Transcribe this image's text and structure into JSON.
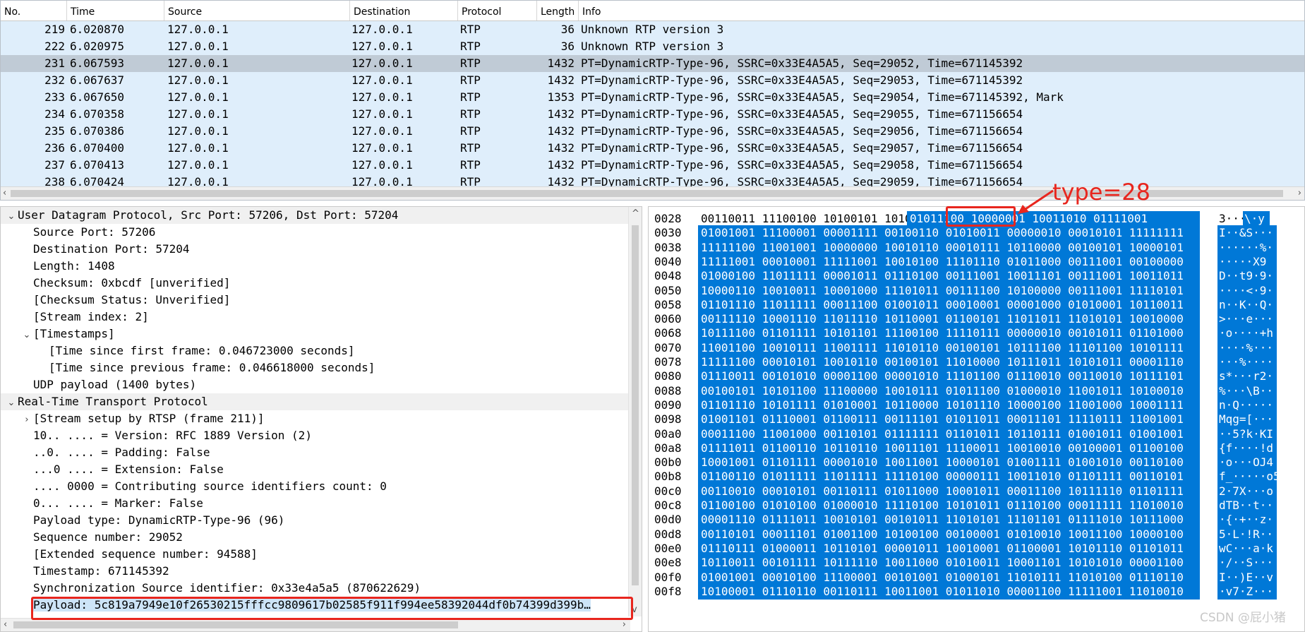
{
  "packet_list": {
    "columns": [
      "No.",
      "Time",
      "Source",
      "Destination",
      "Protocol",
      "Length",
      "Info"
    ],
    "rows": [
      {
        "no": "219",
        "time": "6.020870",
        "src": "127.0.0.1",
        "dst": "127.0.0.1",
        "proto": "RTP",
        "len": "36",
        "info": "Unknown RTP version 3"
      },
      {
        "no": "222",
        "time": "6.020975",
        "src": "127.0.0.1",
        "dst": "127.0.0.1",
        "proto": "RTP",
        "len": "36",
        "info": "Unknown RTP version 3"
      },
      {
        "no": "231",
        "time": "6.067593",
        "src": "127.0.0.1",
        "dst": "127.0.0.1",
        "proto": "RTP",
        "len": "1432",
        "info": "PT=DynamicRTP-Type-96, SSRC=0x33E4A5A5, Seq=29052, Time=671145392"
      },
      {
        "no": "232",
        "time": "6.067637",
        "src": "127.0.0.1",
        "dst": "127.0.0.1",
        "proto": "RTP",
        "len": "1432",
        "info": "PT=DynamicRTP-Type-96, SSRC=0x33E4A5A5, Seq=29053, Time=671145392"
      },
      {
        "no": "233",
        "time": "6.067650",
        "src": "127.0.0.1",
        "dst": "127.0.0.1",
        "proto": "RTP",
        "len": "1353",
        "info": "PT=DynamicRTP-Type-96, SSRC=0x33E4A5A5, Seq=29054, Time=671145392, Mark"
      },
      {
        "no": "234",
        "time": "6.070358",
        "src": "127.0.0.1",
        "dst": "127.0.0.1",
        "proto": "RTP",
        "len": "1432",
        "info": "PT=DynamicRTP-Type-96, SSRC=0x33E4A5A5, Seq=29055, Time=671156654"
      },
      {
        "no": "235",
        "time": "6.070386",
        "src": "127.0.0.1",
        "dst": "127.0.0.1",
        "proto": "RTP",
        "len": "1432",
        "info": "PT=DynamicRTP-Type-96, SSRC=0x33E4A5A5, Seq=29056, Time=671156654"
      },
      {
        "no": "236",
        "time": "6.070400",
        "src": "127.0.0.1",
        "dst": "127.0.0.1",
        "proto": "RTP",
        "len": "1432",
        "info": "PT=DynamicRTP-Type-96, SSRC=0x33E4A5A5, Seq=29057, Time=671156654"
      },
      {
        "no": "237",
        "time": "6.070413",
        "src": "127.0.0.1",
        "dst": "127.0.0.1",
        "proto": "RTP",
        "len": "1432",
        "info": "PT=DynamicRTP-Type-96, SSRC=0x33E4A5A5, Seq=29058, Time=671156654"
      },
      {
        "no": "238",
        "time": "6.070424",
        "src": "127.0.0.1",
        "dst": "127.0.0.1",
        "proto": "RTP",
        "len": "1432",
        "info": "PT=DynamicRTP-Type-96, SSRC=0x33E4A5A5, Seq=29059, Time=671156654"
      }
    ],
    "selected_no": "231"
  },
  "details": {
    "rows": [
      {
        "text": "User Datagram Protocol, Src Port: 57206, Dst Port: 57204",
        "toggle": "v",
        "indent": 0,
        "header": true
      },
      {
        "text": "Source Port: 57206",
        "toggle": "",
        "indent": 1
      },
      {
        "text": "Destination Port: 57204",
        "toggle": "",
        "indent": 1
      },
      {
        "text": "Length: 1408",
        "toggle": "",
        "indent": 1
      },
      {
        "text": "Checksum: 0xbcdf [unverified]",
        "toggle": "",
        "indent": 1
      },
      {
        "text": "[Checksum Status: Unverified]",
        "toggle": "",
        "indent": 1
      },
      {
        "text": "[Stream index: 2]",
        "toggle": "",
        "indent": 1
      },
      {
        "text": "[Timestamps]",
        "toggle": "v",
        "indent": 1
      },
      {
        "text": "[Time since first frame: 0.046723000 seconds]",
        "toggle": "",
        "indent": 2
      },
      {
        "text": "[Time since previous frame: 0.046618000 seconds]",
        "toggle": "",
        "indent": 2
      },
      {
        "text": "UDP payload (1400 bytes)",
        "toggle": "",
        "indent": 1
      },
      {
        "text": "Real-Time Transport Protocol",
        "toggle": "v",
        "indent": 0,
        "header": true
      },
      {
        "text": "[Stream setup by RTSP (frame 211)]",
        "toggle": ">",
        "indent": 1
      },
      {
        "text": "10.. .... = Version: RFC 1889 Version (2)",
        "toggle": "",
        "indent": 1
      },
      {
        "text": "..0. .... = Padding: False",
        "toggle": "",
        "indent": 1
      },
      {
        "text": "...0 .... = Extension: False",
        "toggle": "",
        "indent": 1
      },
      {
        "text": ".... 0000 = Contributing source identifiers count: 0",
        "toggle": "",
        "indent": 1
      },
      {
        "text": "0... .... = Marker: False",
        "toggle": "",
        "indent": 1
      },
      {
        "text": "Payload type: DynamicRTP-Type-96 (96)",
        "toggle": "",
        "indent": 1
      },
      {
        "text": "Sequence number: 29052",
        "toggle": "",
        "indent": 1
      },
      {
        "text": "[Extended sequence number: 94588]",
        "toggle": "",
        "indent": 1
      },
      {
        "text": "Timestamp: 671145392",
        "toggle": "",
        "indent": 1
      },
      {
        "text": "Synchronization Source identifier: 0x33e4a5a5 (870622629)",
        "toggle": "",
        "indent": 1
      },
      {
        "text": "Payload: 5c819a7949e10f26530215fffcc9809617b02585f911f994ee58392044df0b74399d399b…",
        "toggle": "",
        "indent": 1,
        "selected": true
      }
    ]
  },
  "bytes": {
    "rows": [
      {
        "offset": "0028",
        "pre": "00110011 11100100 10100101 10100101 ",
        "bits": "01011100 10000001 10011010 01111001",
        "ascii_pre": "3···",
        "ascii": "\\·y"
      },
      {
        "offset": "0030",
        "bits": "01001001 11100001 00001111 00100110 01010011 00000010 00010101 11111111",
        "ascii": "I··&S···"
      },
      {
        "offset": "0038",
        "bits": "11111100 11001001 10000000 10010110 00010111 10110000 00100101 10000101",
        "ascii": "······%·"
      },
      {
        "offset": "0040",
        "bits": "11111001 00010001 11111001 10010100 11101110 01011000 00111001 00100000",
        "ascii": "·····X9 "
      },
      {
        "offset": "0048",
        "bits": "01000100 11011111 00001011 01110100 00111001 10011101 00111001 10011011",
        "ascii": "D··t9·9·"
      },
      {
        "offset": "0050",
        "bits": "10000110 10010011 10001000 11101011 00111100 10100000 00111001 11110101",
        "ascii": "····<·9·"
      },
      {
        "offset": "0058",
        "bits": "01101110 11011111 00011100 01001011 00010001 00001000 01010001 10110011",
        "ascii": "n··K··Q·"
      },
      {
        "offset": "0060",
        "bits": "00111110 10001110 11011110 10110001 01100101 11011011 11010101 10010000",
        "ascii": ">···e···"
      },
      {
        "offset": "0068",
        "bits": "10111100 01101111 10101101 11100100 11110111 00000010 00101011 01101000",
        "ascii": "·o····+h"
      },
      {
        "offset": "0070",
        "bits": "11001100 10010111 11001111 11010110 00100101 10111100 11101100 10101111",
        "ascii": "····%···"
      },
      {
        "offset": "0078",
        "bits": "11111100 00010101 10010110 00100101 11010000 10111011 10101011 00001110",
        "ascii": "···%····"
      },
      {
        "offset": "0080",
        "bits": "01110011 00101010 00001100 00001010 11101100 01110010 00110010 10111101",
        "ascii": "s*···r2·"
      },
      {
        "offset": "0088",
        "bits": "00100101 10101100 11100000 10010111 01011100 01000010 11001011 10100010",
        "ascii": "%···\\B··"
      },
      {
        "offset": "0090",
        "bits": "01101110 10101111 01010001 10110000 10101110 10000100 11001000 10001111",
        "ascii": "n·Q·····"
      },
      {
        "offset": "0098",
        "bits": "01001101 01110001 01100111 00111101 01011011 00011101 11110111 11001001",
        "ascii": "Mqg=[···"
      },
      {
        "offset": "00a0",
        "bits": "00011100 11001000 00110101 01111111 01101011 10110111 01001011 01001001",
        "ascii": "··5?k·KI"
      },
      {
        "offset": "00a8",
        "bits": "01111011 01100110 10110110 10011101 11100011 10010010 00100001 01100100",
        "ascii": "{f····!d"
      },
      {
        "offset": "00b0",
        "bits": "10001001 01101111 00001010 10011001 10000101 01001111 01001010 00110100",
        "ascii": "·o···OJ4"
      },
      {
        "offset": "00b8",
        "bits": "01100110 01011111 11011111 11110100 00000111 10011010 01101111 00110101",
        "ascii": "f_·····o5"
      },
      {
        "offset": "00c0",
        "bits": "00110010 00010101 00110111 01011000 10001011 00011100 10111110 01101111",
        "ascii": "2·7X···o"
      },
      {
        "offset": "00c8",
        "bits": "01100100 01010100 01000010 11110100 10101011 01110100 00011111 11010010",
        "ascii": "dTB··t··"
      },
      {
        "offset": "00d0",
        "bits": "00001110 01111011 10010101 00101011 11010101 11101101 01111010 10111000",
        "ascii": "·{·+··z·"
      },
      {
        "offset": "00d8",
        "bits": "00110101 00011101 01001100 10100100 00100001 01010010 10011100 10000100",
        "ascii": "5·L·!R··"
      },
      {
        "offset": "00e0",
        "bits": "01110111 01000011 10110101 00001011 10010001 01100001 10101110 01101011",
        "ascii": "wC···a·k"
      },
      {
        "offset": "00e8",
        "bits": "10110011 00101111 10111110 10011000 01010011 10001101 10101010 00001100",
        "ascii": "·/··S···"
      },
      {
        "offset": "00f0",
        "bits": "01001001 00010100 11100001 00101001 01000101 11010111 11010100 01110110",
        "ascii": "I··)E··v"
      },
      {
        "offset": "00f8",
        "bits": "10100001 01110110 00110111 10011001 01011010 00001100 11111001 11010010",
        "ascii": "·v7·Z···"
      }
    ]
  },
  "annotation": {
    "label": "type=28"
  },
  "watermark": "CSDN @屁小猪"
}
